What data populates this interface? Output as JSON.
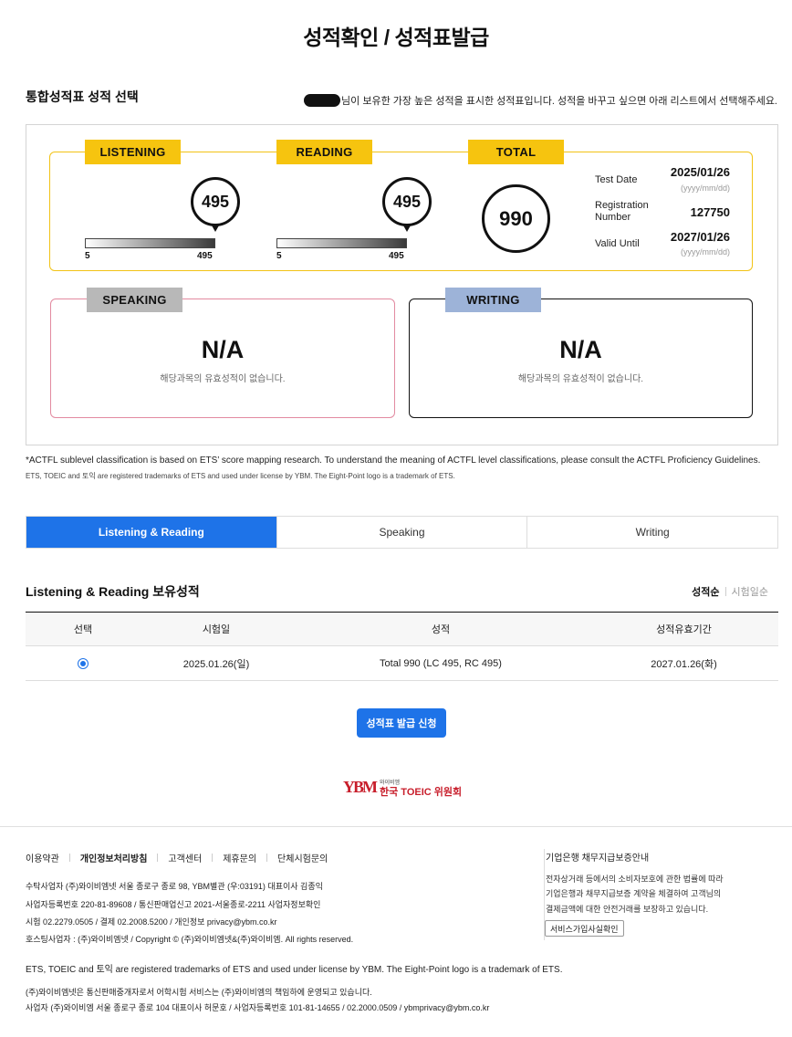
{
  "page": {
    "title": "성적확인 / 성적표발급"
  },
  "summary": {
    "section_title": "통합성적표 성적 선택",
    "notice": "님이 보유한 가장 높은 성적을 표시한 성적표입니다. 성적을 바꾸고 싶으면 아래 리스트에서 선택해주세요."
  },
  "lr": {
    "listening": {
      "label": "LISTENING",
      "score": "495",
      "min": "5",
      "max": "495"
    },
    "reading": {
      "label": "READING",
      "score": "495",
      "min": "5",
      "max": "495"
    },
    "total": {
      "label": "TOTAL",
      "score": "990"
    },
    "info": {
      "test_date_label": "Test Date",
      "test_date": "2025/01/26",
      "test_date_fmt": "(yyyy/mm/dd)",
      "reg_label_1": "Registration",
      "reg_label_2": "Number",
      "reg_number": "127750",
      "valid_label": "Valid Until",
      "valid_until": "2027/01/26",
      "valid_fmt": "(yyyy/mm/dd)"
    }
  },
  "speaking": {
    "label": "SPEAKING",
    "value": "N/A",
    "sub": "해당과목의 유효성적이 없습니다."
  },
  "writing": {
    "label": "WRITING",
    "value": "N/A",
    "sub": "해당과목의 유효성적이 없습니다."
  },
  "fine": {
    "line1": "*ACTFL sublevel classification is based on ETS’ score mapping research. To understand the meaning of ACTFL level classifications, please consult the ACTFL Proficiency Guidelines.",
    "line2": "ETS, TOEIC and 토익 are registered trademarks of ETS and used under license by YBM. The Eight-Point logo is a trademark of ETS."
  },
  "tabs": [
    {
      "label": "Listening & Reading",
      "active": true
    },
    {
      "label": "Speaking",
      "active": false
    },
    {
      "label": "Writing",
      "active": false
    }
  ],
  "holdings": {
    "title": "Listening & Reading 보유성적",
    "sort_score": "성적순",
    "sort_date": "시험일순",
    "columns": [
      "선택",
      "시험일",
      "성적",
      "성적유효기간"
    ],
    "rows": [
      {
        "date": "2025.01.26(일)",
        "score": "Total 990 (LC 495, RC 495)",
        "valid": "2027.01.26(화)"
      }
    ],
    "apply_button": "성적표 발급 신청"
  },
  "logo": {
    "mark": "YBM",
    "sub": "와이비엠",
    "main": "한국 TOEIC 위원회"
  },
  "footer": {
    "links": [
      "이용약관",
      "개인정보처리방침",
      "고객센터",
      "제휴문의",
      "단체시험문의"
    ],
    "info": [
      "수탁사업자 (주)와이비엠넷 서울 종로구 종로 98, YBM별관 (우:03191) 대표이사 김종익",
      "사업자등록번호 220-81-89608 / 통신판매업신고 2021-서울종로-2211 사업자정보확인",
      "시험 02.2279.0505 / 결제 02.2008.5200 / 개인정보 privacy@ybm.co.kr",
      "호스팅사업자 : (주)와이비엠넷 / Copyright © (주)와이비엠넷&(주)와이비엠. All rights reserved."
    ],
    "escrow_title": "기업은행 채무지급보증안내",
    "escrow_text": [
      "전자상거래 등에서의 소비자보호에 관한 법률에 따라",
      "기업은행과 채무지급보증 계약을 체결하여 고객님의",
      "결제금액에 대한 안전거래를 보장하고 있습니다."
    ],
    "escrow_button": "서비스가입사실확인",
    "trademark": "ETS, TOEIC and 토익 are registered trademarks of ETS and used under license by YBM. The Eight-Point logo is a trademark of ETS.",
    "biz": [
      "(주)와이비엠넷은 통신판매중개자로서 어학시험 서비스는 (주)와이비엠의 책임하에 운영되고 있습니다.",
      "사업자 (주)와이비엠 서울 종로구 종로 104 대표이사 허문호 / 사업자등록번호 101-81-14655 / 02.2000.0509 / ybmprivacy@ybm.co.kr"
    ]
  }
}
